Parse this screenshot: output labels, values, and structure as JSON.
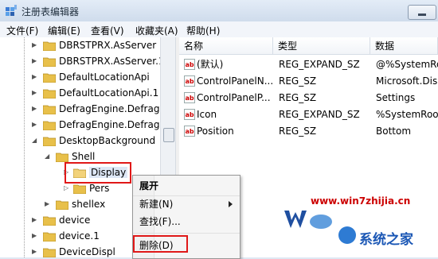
{
  "window": {
    "title": "注册表编辑器"
  },
  "menu": [
    "文件(F)",
    "编辑(E)",
    "查看(V)",
    "收藏夹(A)",
    "帮助(H)"
  ],
  "tree": [
    {
      "label": "DBRSTPRX.AsServer"
    },
    {
      "label": "DBRSTPRX.AsServer.1"
    },
    {
      "label": "DefaultLocationApi"
    },
    {
      "label": "DefaultLocationApi.1"
    },
    {
      "label": "DefragEngine.DefragE"
    },
    {
      "label": "DefragEngine.DefragE"
    },
    {
      "label": "DesktopBackground"
    },
    {
      "label": "Shell"
    },
    {
      "label": "Display"
    },
    {
      "label": "Pers"
    },
    {
      "label": "shellex"
    },
    {
      "label": "device"
    },
    {
      "label": "device.1"
    },
    {
      "label": "DeviceDispl"
    }
  ],
  "list": {
    "columns": [
      "名称",
      "类型",
      "数据"
    ],
    "rows": [
      {
        "name": "(默认)",
        "type": "REG_EXPAND_SZ",
        "data": "@%SystemRo"
      },
      {
        "name": "ControlPanelN...",
        "type": "REG_SZ",
        "data": "Microsoft.Dis"
      },
      {
        "name": "ControlPanelP...",
        "type": "REG_SZ",
        "data": "Settings"
      },
      {
        "name": "Icon",
        "type": "REG_EXPAND_SZ",
        "data": "%SystemRoot"
      },
      {
        "name": "Position",
        "type": "REG_SZ",
        "data": "Bottom"
      }
    ]
  },
  "context_menu": {
    "items": [
      "展开",
      "新建(N)",
      "查找(F)...",
      "删除(D)"
    ]
  },
  "watermark": {
    "site": "www.win7zhijia.cn",
    "brand": "系统之家"
  },
  "colors": {
    "accent_red": "#e01818",
    "folder": "#e8c04a"
  }
}
